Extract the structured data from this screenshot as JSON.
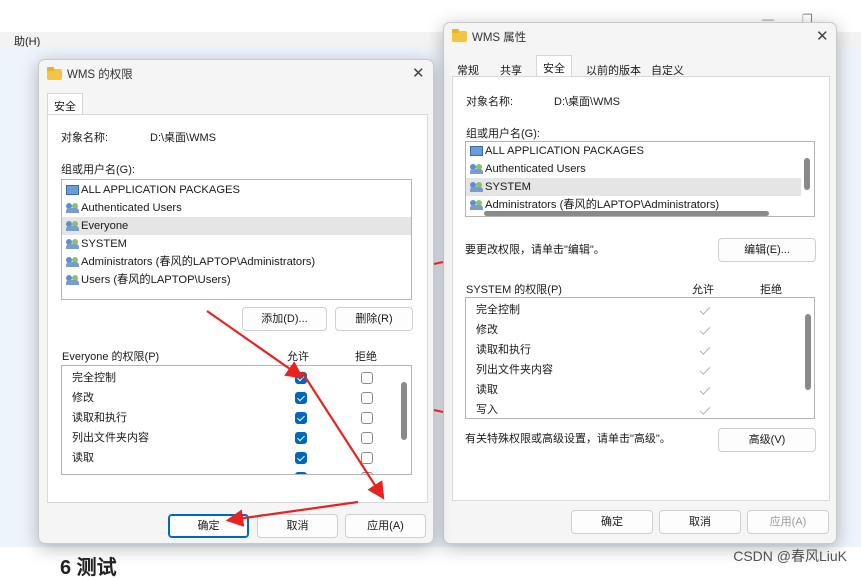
{
  "background": {
    "menu_item": "助(H)",
    "heading": "6 测试",
    "minimize_glyph": "—",
    "restore_glyph": "❐",
    "watermark": "CSDN @春风LiuK"
  },
  "left_dialog": {
    "title": "WMS 的权限",
    "close_glyph": "✕",
    "tab": "安全",
    "object_label": "对象名称:",
    "object_value": "D:\\桌面\\WMS",
    "groups_label": "组或用户名(G):",
    "groups": [
      {
        "name": "ALL APPLICATION PACKAGES",
        "icon": "package-icon",
        "selected": false
      },
      {
        "name": "Authenticated Users",
        "icon": "users-icon",
        "selected": false
      },
      {
        "name": "Everyone",
        "icon": "users-icon",
        "selected": true
      },
      {
        "name": "SYSTEM",
        "icon": "users-icon",
        "selected": false
      },
      {
        "name": "Administrators (春风的LAPTOP\\Administrators)",
        "icon": "users-icon",
        "selected": false
      },
      {
        "name": "Users (春风的LAPTOP\\Users)",
        "icon": "users-icon",
        "selected": false
      }
    ],
    "add_button": "添加(D)...",
    "remove_button": "删除(R)",
    "perm_label": "Everyone 的权限(P)",
    "allow_header": "允许",
    "deny_header": "拒绝",
    "permissions": [
      {
        "name": "完全控制",
        "allow": true,
        "deny": false
      },
      {
        "name": "修改",
        "allow": true,
        "deny": false
      },
      {
        "name": "读取和执行",
        "allow": true,
        "deny": false
      },
      {
        "name": "列出文件夹内容",
        "allow": true,
        "deny": false
      },
      {
        "name": "读取",
        "allow": true,
        "deny": false
      }
    ],
    "ok_button": "确定",
    "cancel_button": "取消",
    "apply_button": "应用(A)"
  },
  "right_dialog": {
    "title": "WMS 属性",
    "close_glyph": "✕",
    "tabs": [
      "常规",
      "共享",
      "安全",
      "以前的版本",
      "自定义"
    ],
    "active_tab": "安全",
    "object_label": "对象名称:",
    "object_value": "D:\\桌面\\WMS",
    "groups_label": "组或用户名(G):",
    "groups": [
      {
        "name": "ALL APPLICATION PACKAGES",
        "icon": "package-icon",
        "selected": false
      },
      {
        "name": "Authenticated Users",
        "icon": "users-icon",
        "selected": false
      },
      {
        "name": "SYSTEM",
        "icon": "users-icon",
        "selected": true
      },
      {
        "name": "Administrators (春风的LAPTOP\\Administrators)",
        "icon": "users-icon",
        "selected": false
      }
    ],
    "edit_hint": "要更改权限，请单击\"编辑\"。",
    "edit_button": "编辑(E)...",
    "perm_label": "SYSTEM 的权限(P)",
    "allow_header": "允许",
    "deny_header": "拒绝",
    "permissions": [
      {
        "name": "完全控制",
        "allow": true,
        "deny": false
      },
      {
        "name": "修改",
        "allow": true,
        "deny": false
      },
      {
        "name": "读取和执行",
        "allow": true,
        "deny": false
      },
      {
        "name": "列出文件夹内容",
        "allow": true,
        "deny": false
      },
      {
        "name": "读取",
        "allow": true,
        "deny": false
      },
      {
        "name": "写入",
        "allow": true,
        "deny": false
      }
    ],
    "advanced_hint": "有关特殊权限或高级设置，请单击\"高级\"。",
    "advanced_button": "高级(V)",
    "ok_button": "确定",
    "cancel_button": "取消",
    "apply_button": "应用(A)"
  },
  "annotation": {
    "arrow_color": "#e8231f"
  }
}
